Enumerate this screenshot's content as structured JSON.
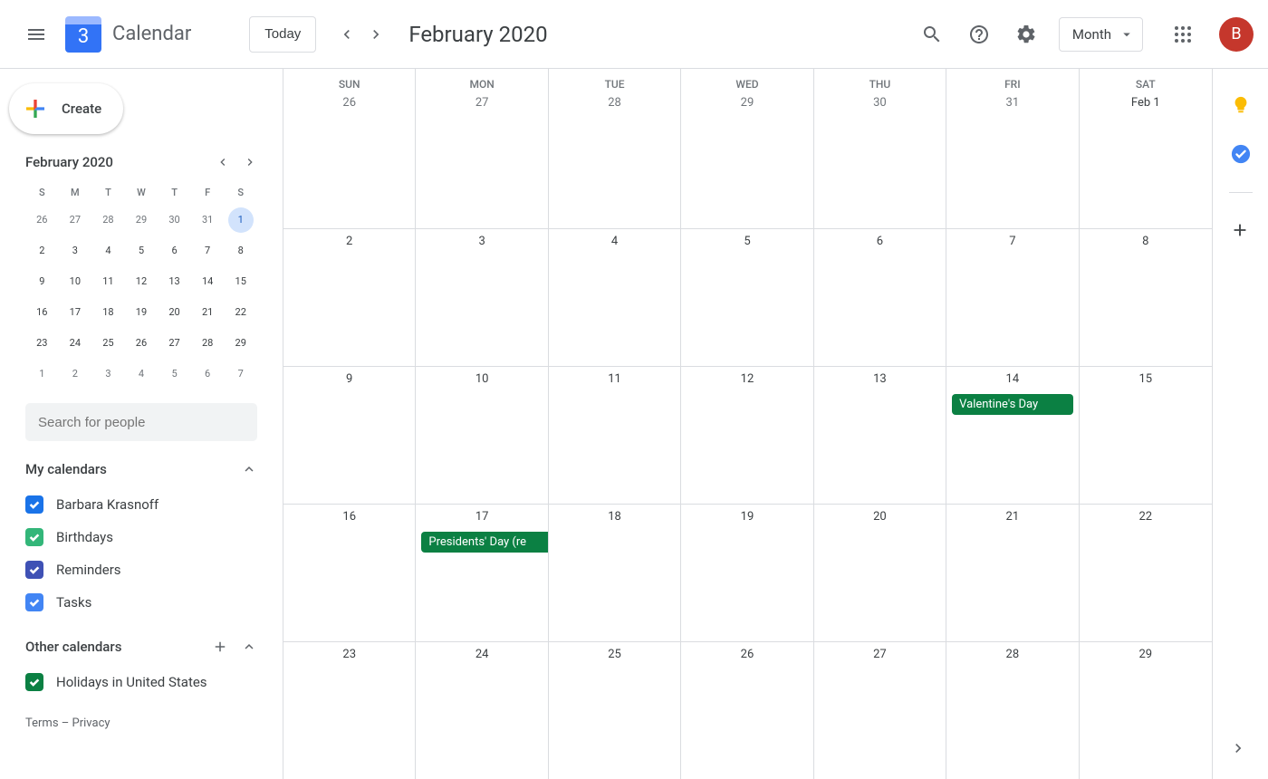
{
  "header": {
    "app_title": "Calendar",
    "logo_day": "3",
    "today_label": "Today",
    "current_range": "February 2020",
    "view_label": "Month",
    "avatar_initial": "B"
  },
  "sidebar": {
    "create_label": "Create",
    "mini": {
      "title": "February 2020",
      "dow": [
        "S",
        "M",
        "T",
        "W",
        "T",
        "F",
        "S"
      ],
      "weeks": [
        [
          {
            "n": "26",
            "o": true
          },
          {
            "n": "27",
            "o": true
          },
          {
            "n": "28",
            "o": true
          },
          {
            "n": "29",
            "o": true
          },
          {
            "n": "30",
            "o": true
          },
          {
            "n": "31",
            "o": true
          },
          {
            "n": "1",
            "sel": true
          }
        ],
        [
          {
            "n": "2"
          },
          {
            "n": "3"
          },
          {
            "n": "4"
          },
          {
            "n": "5"
          },
          {
            "n": "6"
          },
          {
            "n": "7"
          },
          {
            "n": "8"
          }
        ],
        [
          {
            "n": "9"
          },
          {
            "n": "10"
          },
          {
            "n": "11"
          },
          {
            "n": "12"
          },
          {
            "n": "13"
          },
          {
            "n": "14"
          },
          {
            "n": "15"
          }
        ],
        [
          {
            "n": "16"
          },
          {
            "n": "17"
          },
          {
            "n": "18"
          },
          {
            "n": "19"
          },
          {
            "n": "20"
          },
          {
            "n": "21"
          },
          {
            "n": "22"
          }
        ],
        [
          {
            "n": "23"
          },
          {
            "n": "24"
          },
          {
            "n": "25"
          },
          {
            "n": "26"
          },
          {
            "n": "27"
          },
          {
            "n": "28"
          },
          {
            "n": "29"
          }
        ],
        [
          {
            "n": "1",
            "o": true
          },
          {
            "n": "2",
            "o": true
          },
          {
            "n": "3",
            "o": true
          },
          {
            "n": "4",
            "o": true
          },
          {
            "n": "5",
            "o": true
          },
          {
            "n": "6",
            "o": true
          },
          {
            "n": "7",
            "o": true
          }
        ]
      ]
    },
    "search_placeholder": "Search for people",
    "my_calendars": {
      "title": "My calendars",
      "items": [
        {
          "label": "Barbara Krasnoff",
          "color": "#1a73e8"
        },
        {
          "label": "Birthdays",
          "color": "#33b679"
        },
        {
          "label": "Reminders",
          "color": "#3f51b5"
        },
        {
          "label": "Tasks",
          "color": "#4285f4"
        }
      ]
    },
    "other_calendars": {
      "title": "Other calendars",
      "items": [
        {
          "label": "Holidays in United States",
          "color": "#0b8043"
        }
      ]
    },
    "footer": {
      "terms": "Terms",
      "sep": " – ",
      "privacy": "Privacy"
    }
  },
  "grid": {
    "dow": [
      "SUN",
      "MON",
      "TUE",
      "WED",
      "THU",
      "FRI",
      "SAT"
    ],
    "weeks": [
      [
        {
          "n": "26",
          "o": true
        },
        {
          "n": "27",
          "o": true
        },
        {
          "n": "28",
          "o": true
        },
        {
          "n": "29",
          "o": true
        },
        {
          "n": "30",
          "o": true
        },
        {
          "n": "31",
          "o": true
        },
        {
          "n": "Feb 1"
        }
      ],
      [
        {
          "n": "2"
        },
        {
          "n": "3"
        },
        {
          "n": "4"
        },
        {
          "n": "5"
        },
        {
          "n": "6"
        },
        {
          "n": "7"
        },
        {
          "n": "8"
        }
      ],
      [
        {
          "n": "9"
        },
        {
          "n": "10"
        },
        {
          "n": "11"
        },
        {
          "n": "12"
        },
        {
          "n": "13"
        },
        {
          "n": "14",
          "events": [
            {
              "title": "Valentine's Day"
            }
          ]
        },
        {
          "n": "15"
        }
      ],
      [
        {
          "n": "16"
        },
        {
          "n": "17",
          "events": [
            {
              "title": "Presidents' Day (re",
              "cut": true
            }
          ]
        },
        {
          "n": "18"
        },
        {
          "n": "19"
        },
        {
          "n": "20"
        },
        {
          "n": "21"
        },
        {
          "n": "22"
        }
      ],
      [
        {
          "n": "23"
        },
        {
          "n": "24"
        },
        {
          "n": "25"
        },
        {
          "n": "26"
        },
        {
          "n": "27"
        },
        {
          "n": "28"
        },
        {
          "n": "29"
        }
      ]
    ]
  }
}
